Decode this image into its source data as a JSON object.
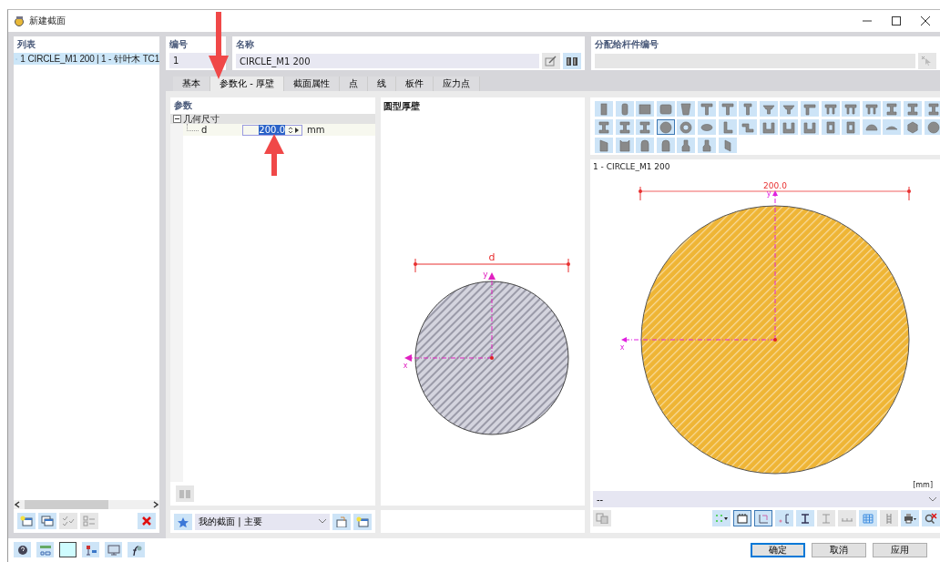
{
  "window": {
    "title": "新建截面"
  },
  "list_panel": {
    "title": "列表",
    "items": [
      {
        "number": "1",
        "label": "CIRCLE_M1 200 | 1 - 针叶木 TC1",
        "selected": true
      }
    ]
  },
  "number_field": {
    "label": "编号",
    "value": "1"
  },
  "name_field": {
    "label": "名称",
    "value": "CIRCLE_M1 200"
  },
  "member_field": {
    "label": "分配给杆件编号"
  },
  "tabs": [
    {
      "label": "基本",
      "selected": false
    },
    {
      "label": "参数化 - 厚壁",
      "selected": true
    },
    {
      "label": "截面属性",
      "selected": false
    },
    {
      "label": "点",
      "selected": false
    },
    {
      "label": "线",
      "selected": false
    },
    {
      "label": "板件",
      "selected": false
    },
    {
      "label": "应力点",
      "selected": false
    }
  ],
  "parameters": {
    "title": "参数",
    "groups": [
      {
        "label": "几何尺寸",
        "expanded": true,
        "children": [
          {
            "symbol": "d",
            "value": "200.0",
            "value_highlighted": true,
            "unit": "mm"
          }
        ]
      }
    ]
  },
  "section_select": {
    "value": "我的截面 | 主要"
  },
  "diagram": {
    "title": "圆型厚壁",
    "dimension_label": "d",
    "y_axis": "y",
    "x_axis": "x"
  },
  "shape_palette": [
    {
      "kind": "rect",
      "selected": false
    },
    {
      "kind": "rounded-rect",
      "selected": false
    },
    {
      "kind": "square",
      "selected": false
    },
    {
      "kind": "rounded-square",
      "selected": false
    },
    {
      "kind": "trapezoid",
      "selected": false
    },
    {
      "kind": "tee",
      "selected": false
    },
    {
      "kind": "tee",
      "selected": false
    },
    {
      "kind": "narrow-tee",
      "selected": false
    },
    {
      "kind": "inverted-tee",
      "selected": false
    },
    {
      "kind": "inverted-tee",
      "selected": false
    },
    {
      "kind": "tee-flange",
      "selected": false
    },
    {
      "kind": "pi",
      "selected": false
    },
    {
      "kind": "pi",
      "selected": false
    },
    {
      "kind": "pi",
      "selected": false
    },
    {
      "kind": "ibeam",
      "selected": false
    },
    {
      "kind": "ibeam",
      "selected": false
    },
    {
      "kind": "ibeam",
      "selected": false
    },
    {
      "kind": "ibeam",
      "selected": false
    },
    {
      "kind": "ibeam",
      "selected": false
    },
    {
      "kind": "ibeam",
      "selected": false
    },
    {
      "kind": "circle",
      "selected": true
    },
    {
      "kind": "ring",
      "selected": false
    },
    {
      "kind": "ellipse",
      "selected": false
    },
    {
      "kind": "angle",
      "selected": false
    },
    {
      "kind": "zee",
      "selected": false
    },
    {
      "kind": "channel",
      "selected": false
    },
    {
      "kind": "channel",
      "selected": false
    },
    {
      "kind": "channel",
      "selected": false
    },
    {
      "kind": "box",
      "selected": false
    },
    {
      "kind": "box",
      "selected": false
    },
    {
      "kind": "semicircle",
      "selected": false
    },
    {
      "kind": "segment",
      "selected": false
    },
    {
      "kind": "hexagon",
      "selected": false
    },
    {
      "kind": "circle",
      "selected": false
    },
    {
      "kind": "chamfer",
      "selected": false
    },
    {
      "kind": "notched",
      "selected": false
    },
    {
      "kind": "arch",
      "selected": false
    },
    {
      "kind": "arch",
      "selected": false
    },
    {
      "kind": "bottle",
      "selected": false
    },
    {
      "kind": "bottle",
      "selected": false
    },
    {
      "kind": "parallelogram",
      "selected": false
    }
  ],
  "preview": {
    "title": "1 - CIRCLE_M1 200",
    "dimension_label": "200.0",
    "y_axis": "y",
    "x_axis": "x",
    "unit": "[mm]"
  },
  "preview_select": {
    "value": "--"
  },
  "buttons": [
    {
      "label": "确定",
      "default": true
    },
    {
      "label": "取消",
      "default": false
    },
    {
      "label": "应用",
      "default": false
    }
  ]
}
